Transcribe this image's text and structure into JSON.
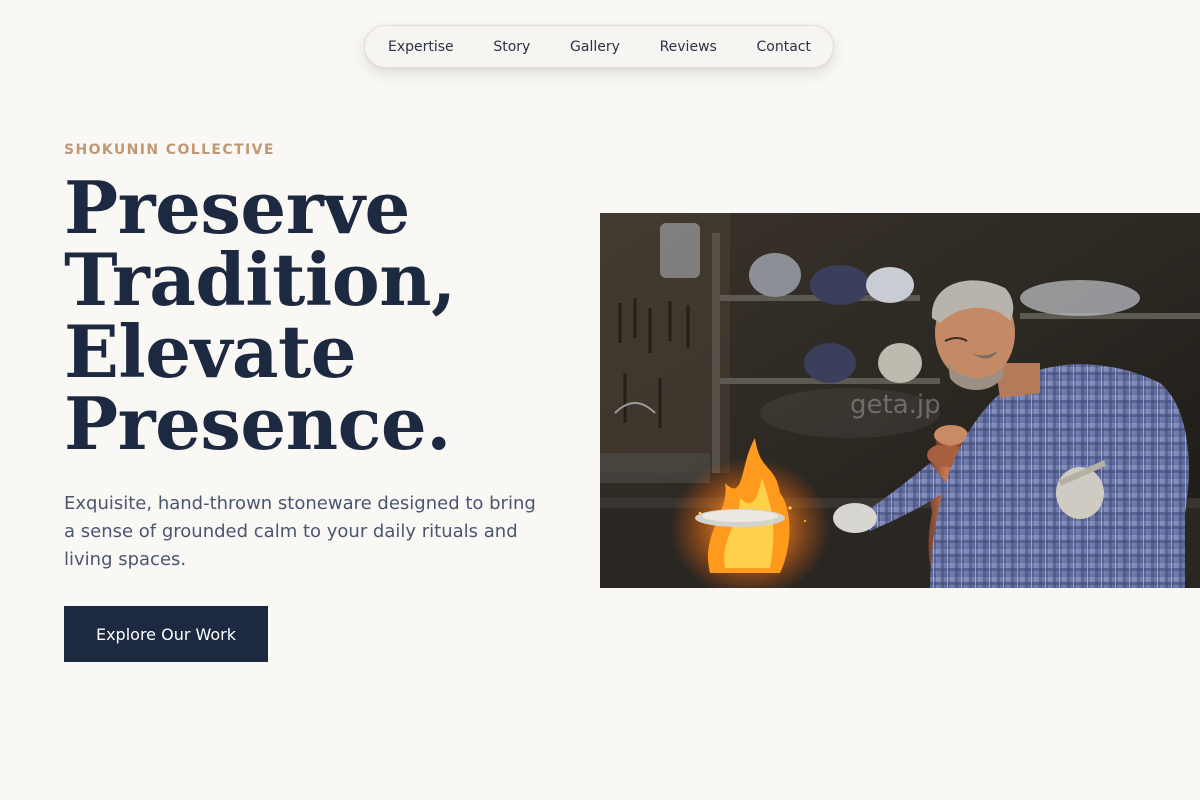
{
  "nav": {
    "items": [
      {
        "label": "Expertise"
      },
      {
        "label": "Story"
      },
      {
        "label": "Gallery"
      },
      {
        "label": "Reviews"
      },
      {
        "label": "Contact"
      }
    ]
  },
  "hero": {
    "eyebrow": "SHOKUNIN COLLECTIVE",
    "headline_lines": [
      "Preserve",
      "Tradition,",
      "Elevate",
      "Presence."
    ],
    "description": "Exquisite, hand-thrown stoneware designed to bring a sense of grounded calm to your daily rituals and living spaces.",
    "cta_label": "Explore Our Work",
    "image": {
      "watermark": "geta.jp",
      "alt": "Craftsman heating a copper pot over an open flame in a workshop"
    }
  },
  "colors": {
    "background": "#f9f8f5",
    "navy": "#1c2940",
    "accent": "#c19873",
    "body_text": "#4a5670"
  }
}
